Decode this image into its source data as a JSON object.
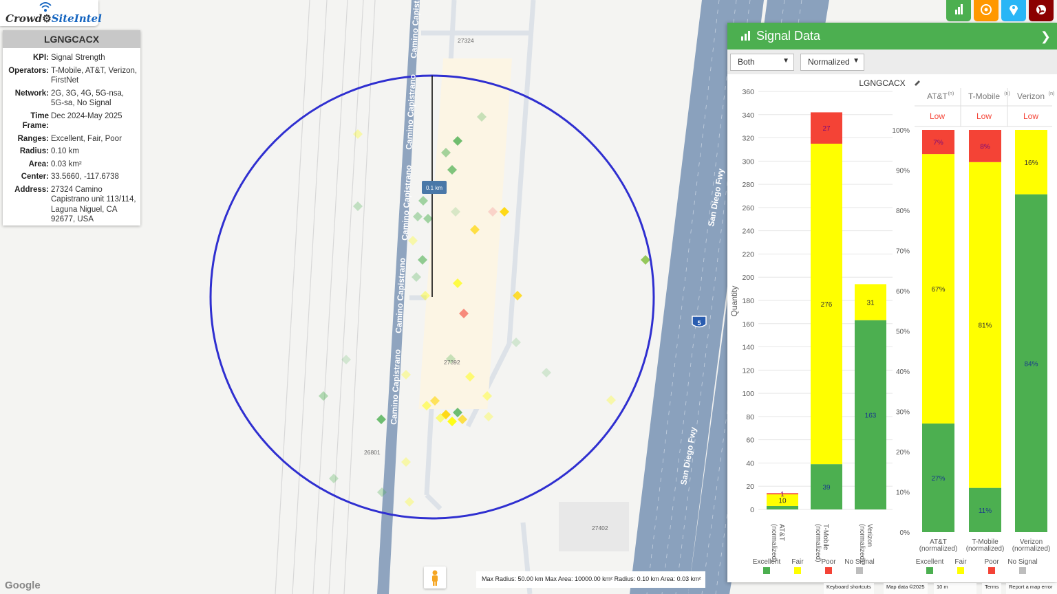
{
  "brand": {
    "part1": "Crowd",
    "part2": "SiteIntel"
  },
  "info": {
    "title": "LGNGCACX",
    "rows": [
      {
        "k": "KPI:",
        "v": "Signal Strength"
      },
      {
        "k": "Operators:",
        "v": "T-Mobile, AT&T, Verizon, FirstNet"
      },
      {
        "k": "Network:",
        "v": "2G, 3G, 4G, 5G-nsa, 5G-sa, No Signal"
      },
      {
        "k": "Time Frame:",
        "v": "Dec 2024-May 2025"
      },
      {
        "k": "Ranges:",
        "v": "Excellent, Fair, Poor"
      },
      {
        "k": "Radius:",
        "v": "0.10 km"
      },
      {
        "k": "Area:",
        "v": "0.03 km²"
      },
      {
        "k": "Center:",
        "v": "33.5660, -117.6738"
      },
      {
        "k": "Address:",
        "v": "27324 Camino Capistrano unit 113/114, Laguna Niguel, CA 92677, USA"
      }
    ]
  },
  "map": {
    "road_labels": [
      "Camino Capistrano",
      "Camino Capistrano",
      "Camino Capistrano",
      "Camino Capistrano",
      "Camino Capistrano",
      "San Diego Fwy",
      "San Diego Fwy"
    ],
    "addresses": [
      "27324",
      "27392",
      "26801",
      "27402"
    ],
    "radius_label": "0.1 km",
    "shield": "5"
  },
  "toolbar": {
    "colors": [
      "#4caf50",
      "#ff9800",
      "#29b6f6",
      "#8b0000"
    ],
    "icons": [
      "bar-chart-icon",
      "target-icon",
      "pin-icon",
      "globe-icon"
    ]
  },
  "panel": {
    "title": "Signal Data",
    "select1": "Both",
    "select2": "Normalized",
    "chart_title": "LGNGCACX"
  },
  "chart_data": [
    {
      "type": "bar",
      "title": "LGNGCACX",
      "ylabel": "Quantity",
      "ylim": [
        0,
        360
      ],
      "yticks": [
        0,
        20,
        40,
        60,
        80,
        100,
        120,
        140,
        160,
        180,
        200,
        220,
        240,
        260,
        280,
        300,
        320,
        340,
        360
      ],
      "categories": [
        "AT&T (normalized)",
        "T-Mobile (normalized)",
        "Verizon (normalized)"
      ],
      "series": [
        {
          "name": "Excellent",
          "color": "#4caf50",
          "values": [
            3,
            39,
            163
          ]
        },
        {
          "name": "Fair",
          "color": "#ffff00",
          "values": [
            10,
            276,
            31
          ]
        },
        {
          "name": "Poor",
          "color": "#f44336",
          "values": [
            1,
            27,
            0
          ]
        },
        {
          "name": "No Signal",
          "color": "#bdbdbd",
          "values": [
            0,
            0,
            0
          ]
        }
      ],
      "labels": [
        [
          null,
          "39",
          "163"
        ],
        [
          "10",
          "276",
          "31"
        ],
        [
          "1",
          "27",
          null
        ]
      ]
    },
    {
      "type": "bar",
      "ylim": [
        0,
        100
      ],
      "yticks": [
        "0%",
        "10%",
        "20%",
        "30%",
        "40%",
        "50%",
        "60%",
        "70%",
        "80%",
        "90%",
        "100%"
      ],
      "header": [
        {
          "name": "AT&T",
          "sup": "(n)",
          "rating": "Low"
        },
        {
          "name": "T-Mobile",
          "sup": "(n)",
          "rating": "Low"
        },
        {
          "name": "Verizon",
          "sup": "(n)",
          "rating": "Low"
        }
      ],
      "categories": [
        "AT&T (normalized)",
        "T-Mobile (normalized)",
        "Verizon (normalized)"
      ],
      "series": [
        {
          "name": "Excellent",
          "color": "#4caf50",
          "values": [
            27,
            11,
            84
          ]
        },
        {
          "name": "Fair",
          "color": "#ffff00",
          "values": [
            67,
            81,
            16
          ]
        },
        {
          "name": "Poor",
          "color": "#f44336",
          "values": [
            7,
            8,
            0
          ]
        },
        {
          "name": "No Signal",
          "color": "#bdbdbd",
          "values": [
            0,
            0,
            0
          ]
        }
      ],
      "labels": [
        [
          "27%",
          "11%",
          "84%"
        ],
        [
          "67%",
          "81%",
          "16%"
        ],
        [
          "7%",
          "8%",
          null
        ]
      ]
    }
  ],
  "legend": [
    "Excellent",
    "Fair",
    "Poor",
    "No Signal"
  ],
  "footer": {
    "text": "Max Radius: 50.00 km Max Area: 10000.00 km² Radius: 0.10 km Area: 0.03 km²"
  },
  "google": "Google",
  "attrib": {
    "keys": "Keyboard shortcuts",
    "data": "Map data ©2025",
    "scale": "10 m",
    "terms": "Terms",
    "report": "Report a map error"
  }
}
